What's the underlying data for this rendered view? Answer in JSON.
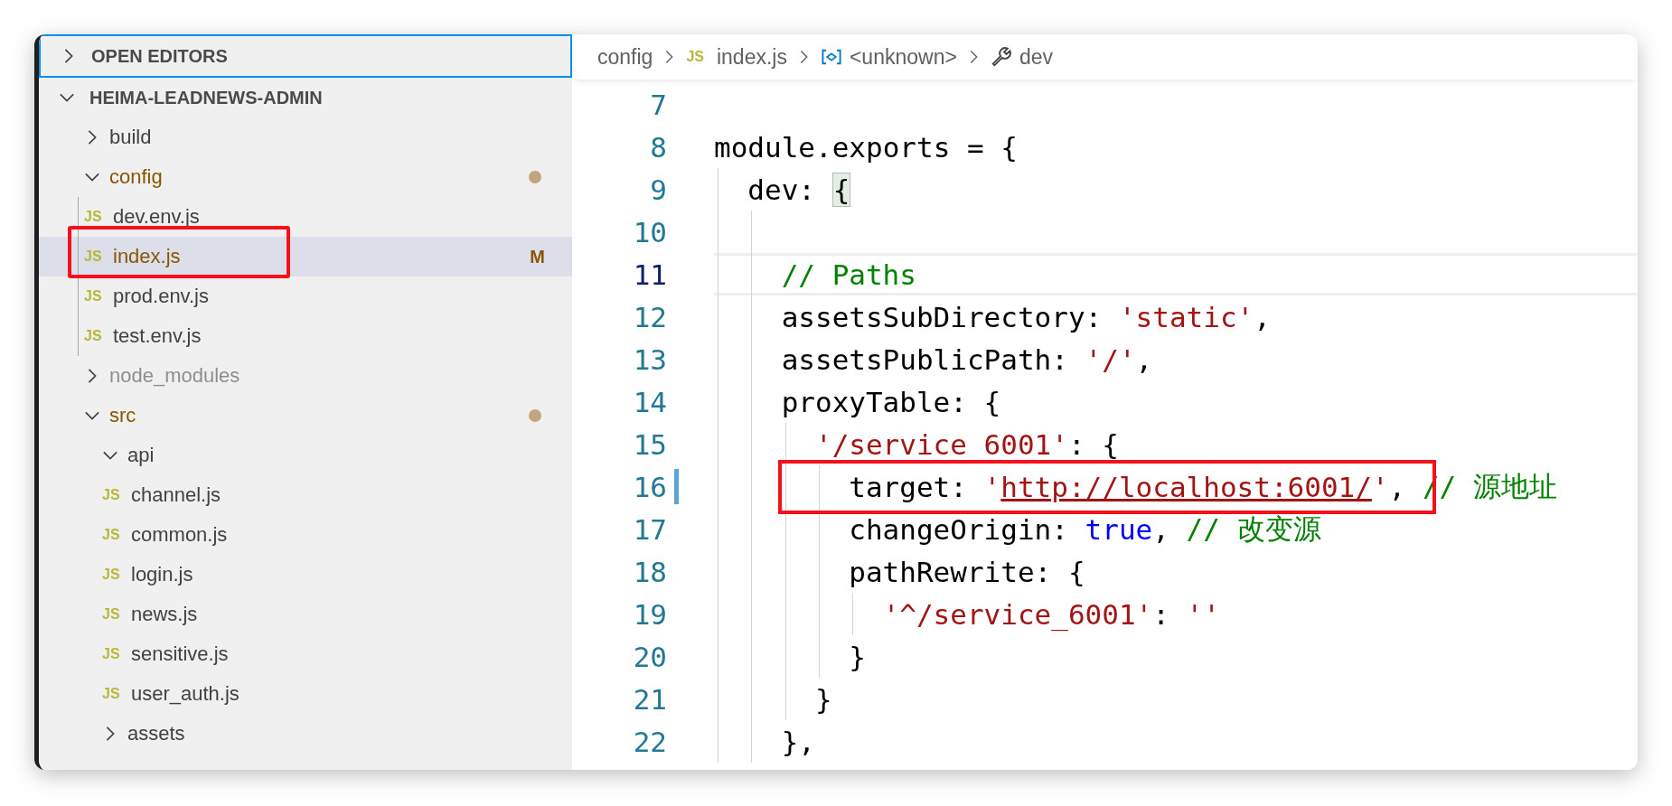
{
  "sidebar": {
    "open_editors": {
      "label": "OPEN EDITORS",
      "expanded": false,
      "focused": true
    },
    "project": {
      "label": "HEIMA-LEADNEWS-ADMIN",
      "expanded": true,
      "items": [
        {
          "kind": "folder",
          "name": "build",
          "expanded": false,
          "modified": false,
          "ignored": false,
          "selected": false
        },
        {
          "kind": "folder",
          "name": "config",
          "expanded": true,
          "modified": true,
          "ignored": false,
          "selected": false,
          "children": [
            {
              "kind": "file",
              "icon": "JS",
              "name": "dev.env.js",
              "modified": false,
              "ignored": false,
              "selected": false
            },
            {
              "kind": "file",
              "icon": "JS",
              "name": "index.js",
              "modified": true,
              "ignored": false,
              "badge": "M",
              "selected": true,
              "annotated": true
            },
            {
              "kind": "file",
              "icon": "JS",
              "name": "prod.env.js",
              "modified": false,
              "ignored": false,
              "selected": false
            },
            {
              "kind": "file",
              "icon": "JS",
              "name": "test.env.js",
              "modified": false,
              "ignored": false,
              "selected": false
            }
          ]
        },
        {
          "kind": "folder",
          "name": "node_modules",
          "expanded": false,
          "modified": false,
          "ignored": true,
          "selected": false
        },
        {
          "kind": "folder",
          "name": "src",
          "expanded": true,
          "modified": true,
          "ignored": false,
          "selected": false,
          "children": [
            {
              "kind": "folder",
              "name": "api",
              "expanded": true,
              "modified": false,
              "ignored": false,
              "selected": false,
              "children": [
                {
                  "kind": "file",
                  "icon": "JS",
                  "name": "channel.js",
                  "modified": false,
                  "ignored": false,
                  "selected": false
                },
                {
                  "kind": "file",
                  "icon": "JS",
                  "name": "common.js",
                  "modified": false,
                  "ignored": false,
                  "selected": false
                },
                {
                  "kind": "file",
                  "icon": "JS",
                  "name": "login.js",
                  "modified": false,
                  "ignored": false,
                  "selected": false
                },
                {
                  "kind": "file",
                  "icon": "JS",
                  "name": "news.js",
                  "modified": false,
                  "ignored": false,
                  "selected": false
                },
                {
                  "kind": "file",
                  "icon": "JS",
                  "name": "sensitive.js",
                  "modified": false,
                  "ignored": false,
                  "selected": false
                },
                {
                  "kind": "file",
                  "icon": "JS",
                  "name": "user_auth.js",
                  "modified": false,
                  "ignored": false,
                  "selected": false
                }
              ]
            },
            {
              "kind": "folder",
              "name": "assets",
              "expanded": false,
              "modified": false,
              "ignored": false,
              "selected": false
            }
          ]
        }
      ]
    }
  },
  "editor": {
    "breadcrumbs": [
      {
        "kind": "folder",
        "text": "config"
      },
      {
        "kind": "file",
        "icon": "JS",
        "text": "index.js"
      },
      {
        "kind": "symbol",
        "text": "<unknown>"
      },
      {
        "kind": "property",
        "text": "dev"
      }
    ],
    "lines": [
      {
        "number": "7",
        "current": false,
        "modified": false
      },
      {
        "number": "8",
        "current": false,
        "modified": false,
        "tokens": [
          {
            "kind": "plain",
            "text": "module.exports = {"
          }
        ]
      },
      {
        "number": "9",
        "current": false,
        "modified": false,
        "tokens": [
          {
            "kind": "plain",
            "text": "dev: "
          },
          {
            "kind": "bracket_match",
            "text": "{"
          }
        ]
      },
      {
        "number": "10",
        "current": false,
        "modified": false
      },
      {
        "number": "11",
        "current": true,
        "modified": false,
        "tokens": [
          {
            "kind": "comment",
            "text": "// Paths"
          }
        ]
      },
      {
        "number": "12",
        "current": false,
        "modified": false,
        "tokens": [
          {
            "kind": "plain",
            "text": "assetsSubDirectory: "
          },
          {
            "kind": "string",
            "text": "'static'"
          },
          {
            "kind": "plain",
            "text": ","
          }
        ]
      },
      {
        "number": "13",
        "current": false,
        "modified": false,
        "tokens": [
          {
            "kind": "plain",
            "text": "assetsPublicPath: "
          },
          {
            "kind": "string",
            "text": "'/'"
          },
          {
            "kind": "plain",
            "text": ","
          }
        ]
      },
      {
        "number": "14",
        "current": false,
        "modified": false,
        "tokens": [
          {
            "kind": "plain",
            "text": "proxyTable: {"
          }
        ]
      },
      {
        "number": "15",
        "current": false,
        "modified": false,
        "tokens": [
          {
            "kind": "string",
            "text": "'/service 6001'"
          },
          {
            "kind": "plain",
            "text": ": {"
          }
        ]
      },
      {
        "number": "16",
        "current": false,
        "modified": true,
        "annotated": true,
        "tokens": [
          {
            "kind": "plain",
            "text": "target: "
          },
          {
            "kind": "string",
            "text": "'"
          },
          {
            "kind": "link",
            "text": "http://localhost:6001/"
          },
          {
            "kind": "string",
            "text": "'"
          },
          {
            "kind": "plain",
            "text": ", "
          },
          {
            "kind": "comment",
            "text": "// 源地址"
          }
        ]
      },
      {
        "number": "17",
        "current": false,
        "modified": false,
        "tokens": [
          {
            "kind": "plain",
            "text": "changeOrigin: "
          },
          {
            "kind": "keyword",
            "text": "true"
          },
          {
            "kind": "plain",
            "text": ", "
          },
          {
            "kind": "comment",
            "text": "// 改变源"
          }
        ]
      },
      {
        "number": "18",
        "current": false,
        "modified": false,
        "tokens": [
          {
            "kind": "plain",
            "text": "pathRewrite: {"
          }
        ]
      },
      {
        "number": "19",
        "current": false,
        "modified": false,
        "tokens": [
          {
            "kind": "string",
            "text": "'^/service_6001'"
          },
          {
            "kind": "plain",
            "text": ": "
          },
          {
            "kind": "string",
            "text": "''"
          }
        ]
      },
      {
        "number": "20",
        "current": false,
        "modified": false,
        "tokens": [
          {
            "kind": "plain",
            "text": "}"
          }
        ]
      },
      {
        "number": "21",
        "current": false,
        "modified": false,
        "tokens": [
          {
            "kind": "plain",
            "text": "}"
          }
        ]
      },
      {
        "number": "22",
        "current": false,
        "modified": false,
        "tokens": [
          {
            "kind": "plain",
            "text": "},"
          }
        ]
      }
    ]
  }
}
